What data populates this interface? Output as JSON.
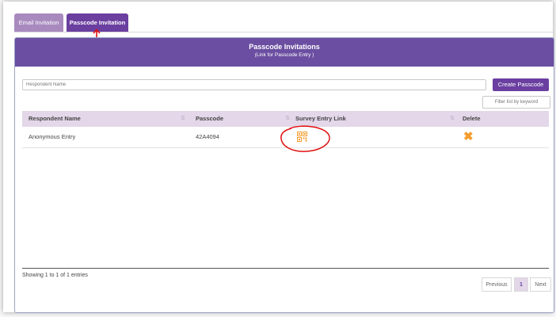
{
  "tabs": {
    "email": "Email Invitation",
    "passcode": "Passcode Invitation"
  },
  "panel": {
    "title": "Passcode Invitations",
    "subtitle": "(Link for Passcode Entry )"
  },
  "form": {
    "name_placeholder": "Respondent Name",
    "create_label": "Create Passcode",
    "filter_placeholder": "Filter list by keyword"
  },
  "table": {
    "headers": [
      "Respondent Name",
      "Passcode",
      "Survey Entry Link",
      "Delete"
    ],
    "rows": [
      {
        "name": "Anonymous Entry",
        "passcode": "42A4094",
        "link_icon": "qr-code-icon",
        "delete_icon": "delete-x-icon"
      }
    ]
  },
  "footer": {
    "showing": "Showing 1 to 1 of 1 entries",
    "prev": "Previous",
    "page": "1",
    "next": "Next"
  },
  "colors": {
    "accent": "#6a3fa0",
    "tab_inactive": "#a88abf",
    "header_bg": "#6b4ea1",
    "table_head": "#e3d7e9",
    "delete": "#f39c2c",
    "annotation": "#e01010"
  }
}
